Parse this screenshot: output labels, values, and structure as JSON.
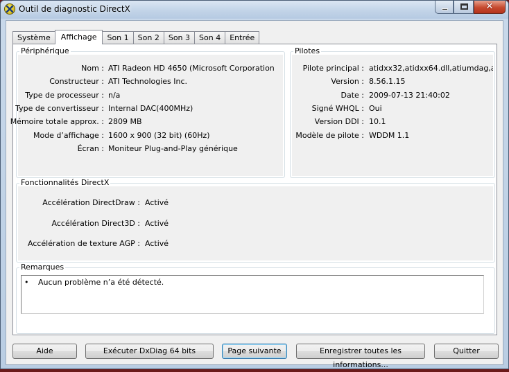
{
  "window": {
    "title": "Outil de diagnostic DirectX",
    "close_glyph": "✕"
  },
  "tabs": [
    {
      "label": "Système"
    },
    {
      "label": "Affichage"
    },
    {
      "label": "Son 1"
    },
    {
      "label": "Son 2"
    },
    {
      "label": "Son 3"
    },
    {
      "label": "Son 4"
    },
    {
      "label": "Entrée"
    }
  ],
  "device": {
    "title": "Périphérique",
    "rows": [
      {
        "label": "Nom :",
        "value": "ATI Radeon HD 4650 (Microsoft Corporation"
      },
      {
        "label": "Constructeur :",
        "value": "ATI Technologies Inc."
      },
      {
        "label": "Type de processeur :",
        "value": "n/a"
      },
      {
        "label": "Type de convertisseur :",
        "value": "Internal DAC(400MHz)"
      },
      {
        "label": "Mémoire totale approx. :",
        "value": "2809 MB"
      },
      {
        "label": "Mode d’affichage :",
        "value": "1600 x 900 (32 bit) (60Hz)"
      },
      {
        "label": "Écran :",
        "value": "Moniteur Plug-and-Play générique"
      }
    ]
  },
  "drivers": {
    "title": "Pilotes",
    "rows": [
      {
        "label": "Pilote principal :",
        "value": "atidxx32,atidxx64.dll,atiumdag,atium"
      },
      {
        "label": "Version :",
        "value": "8.56.1.15"
      },
      {
        "label": "Date :",
        "value": "2009-07-13 21:40:02"
      },
      {
        "label": "Signé WHQL :",
        "value": "Oui"
      },
      {
        "label": "Version DDI :",
        "value": "10.1"
      },
      {
        "label": "Modèle de pilote :",
        "value": "WDDM 1.1"
      }
    ]
  },
  "features": {
    "title": "Fonctionnalités DirectX",
    "rows": [
      {
        "label": "Accélération DirectDraw :",
        "value": "Activé"
      },
      {
        "label": "Accélération Direct3D :",
        "value": "Activé"
      },
      {
        "label": "Accélération de texture AGP :",
        "value": "Activé"
      }
    ]
  },
  "notes": {
    "title": "Remarques",
    "bullet": "•",
    "items": [
      "Aucun problème n’a été détecté."
    ]
  },
  "buttons": {
    "help": "Aide",
    "run64": "Exécuter DxDiag 64 bits",
    "next": "Page suivante",
    "save": "Enregistrer toutes les informations...",
    "quit": "Quitter"
  }
}
